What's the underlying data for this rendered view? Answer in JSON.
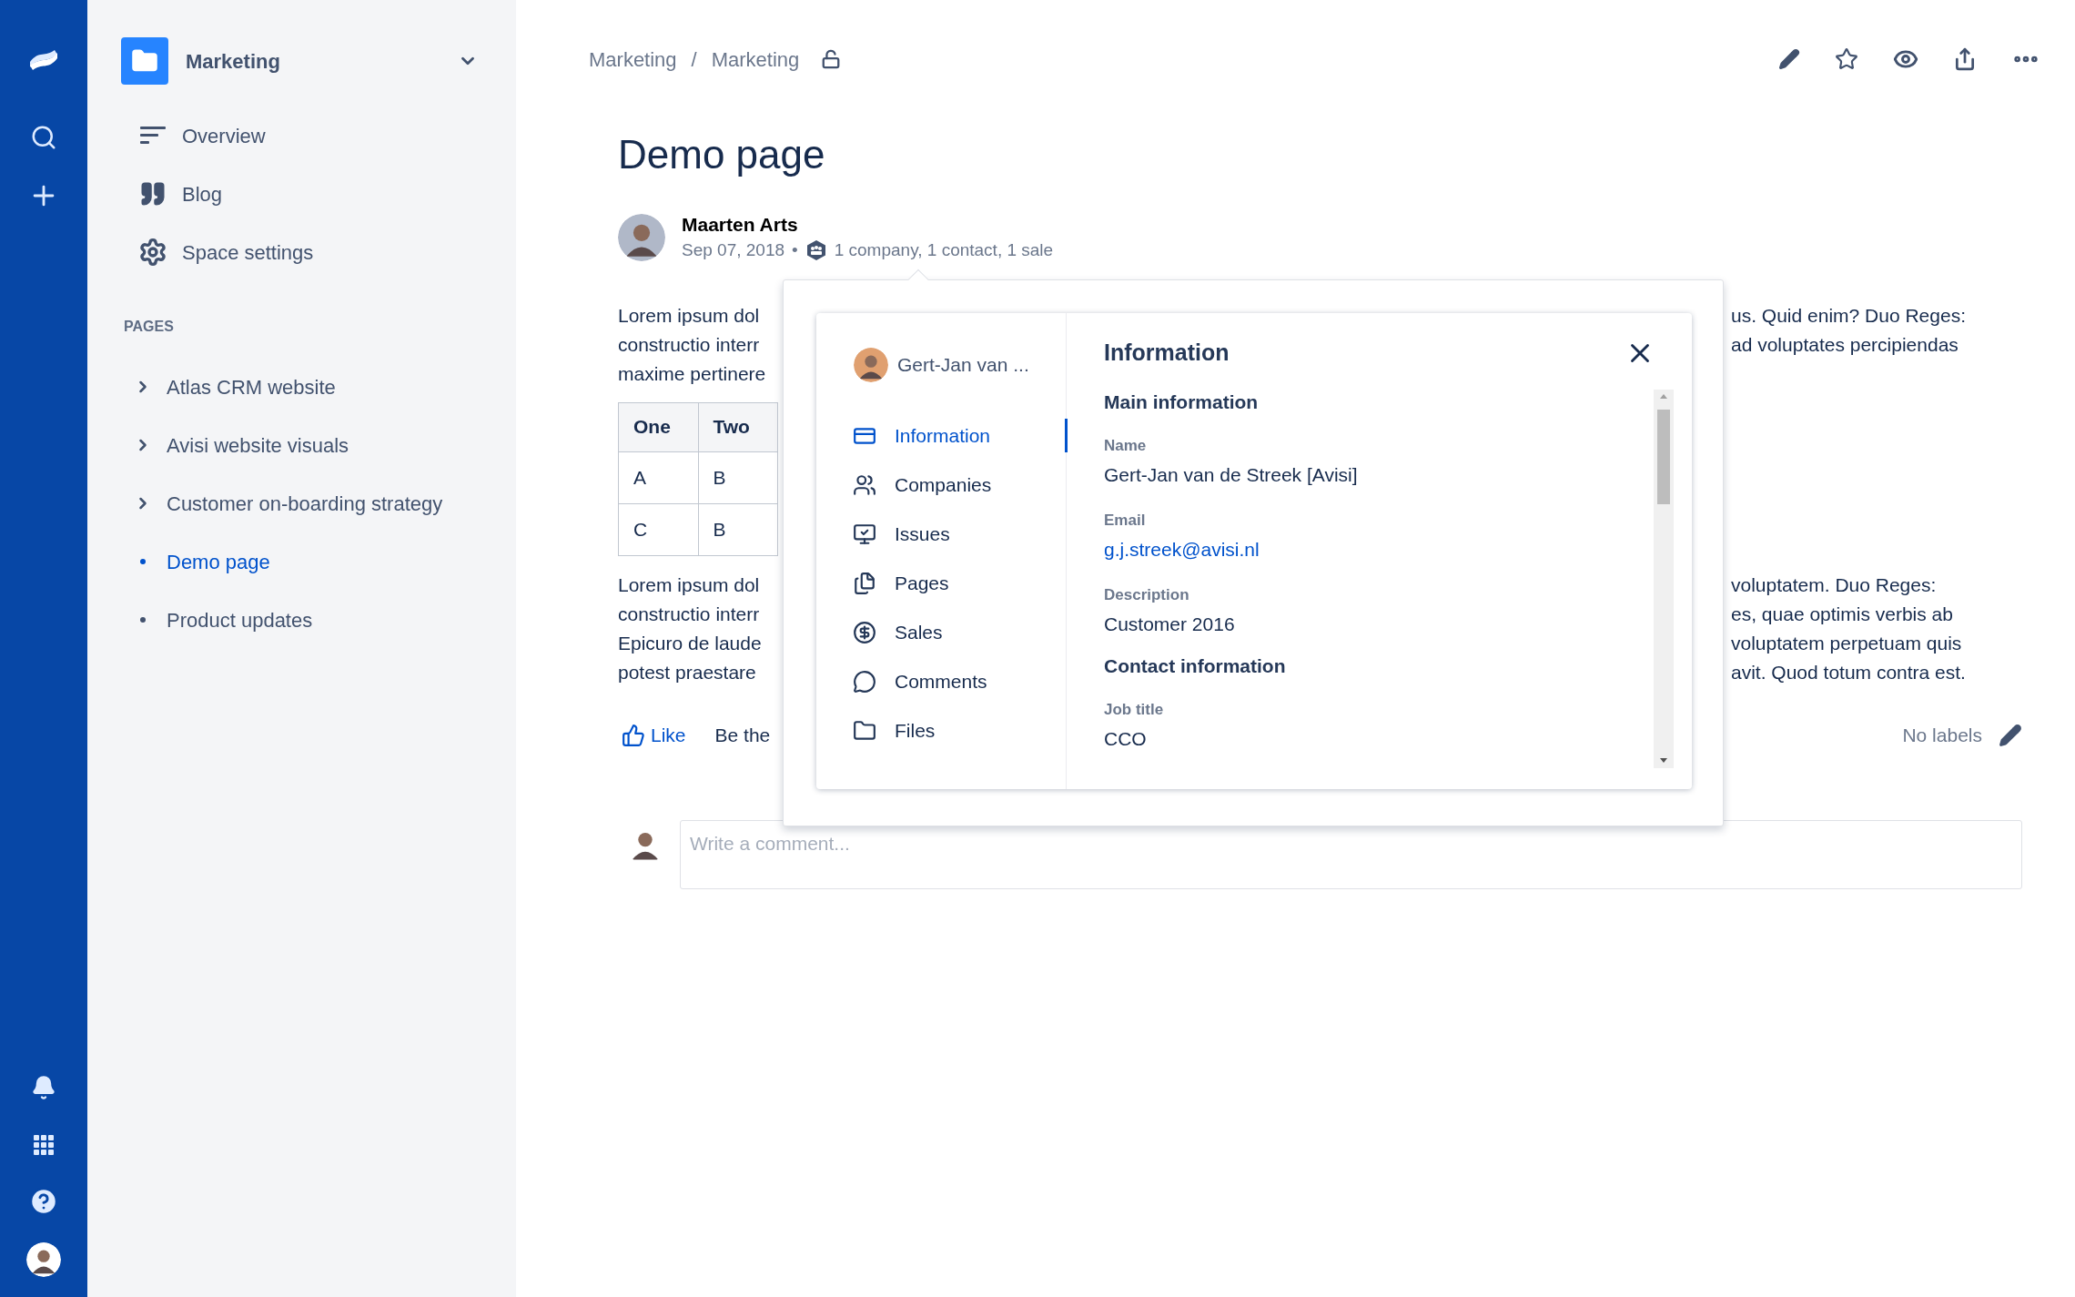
{
  "space": {
    "name": "Marketing"
  },
  "sidebar": {
    "items": [
      {
        "label": "Overview"
      },
      {
        "label": "Blog"
      },
      {
        "label": "Space settings"
      }
    ]
  },
  "pages_heading": "PAGES",
  "pages": [
    {
      "label": "Atlas CRM website",
      "has_children": true,
      "selected": false
    },
    {
      "label": "Avisi website visuals",
      "has_children": true,
      "selected": false
    },
    {
      "label": "Customer on-boarding strategy",
      "has_children": true,
      "selected": false
    },
    {
      "label": "Demo page",
      "has_children": false,
      "selected": true
    },
    {
      "label": "Product updates",
      "has_children": false,
      "selected": false
    }
  ],
  "breadcrumbs": [
    "Marketing",
    "Marketing"
  ],
  "breadcrumb_separator": "/",
  "title": "Demo page",
  "author": {
    "name": "Maarten Arts",
    "date": "Sep 07, 2018",
    "bullet": "•",
    "summary": "1 company, 1 contact, 1 sale"
  },
  "paragraphs": [
    {
      "left_lines": [
        "Lorem ipsum dol",
        "constructio interr",
        "maxime pertinere"
      ],
      "right_lines": [
        "us. Quid enim? Duo Reges:",
        "ad voluptates percipiendas"
      ]
    },
    {
      "left_lines": [
        "Lorem ipsum dol",
        "constructio interr",
        "Epicuro de laude",
        "potest praestare"
      ],
      "right_lines": [
        "voluptatem. Duo Reges:",
        "es, quae optimis verbis ab",
        "voluptatem perpetuam quis",
        "avit. Quod totum contra est."
      ]
    }
  ],
  "table": {
    "columns": [
      "One",
      "Two"
    ],
    "rows": [
      [
        "A",
        "B"
      ],
      [
        "C",
        "B"
      ]
    ]
  },
  "like": {
    "label": "Like",
    "text": "Be the"
  },
  "labels": "No labels",
  "comment": {
    "placeholder": "Write a comment..."
  },
  "popup": {
    "contact_name": "Gert-Jan van ...",
    "nav": [
      {
        "label": "Information",
        "selected": true
      },
      {
        "label": "Companies",
        "selected": false
      },
      {
        "label": "Issues",
        "selected": false
      },
      {
        "label": "Pages",
        "selected": false
      },
      {
        "label": "Sales",
        "selected": false
      },
      {
        "label": "Comments",
        "selected": false
      },
      {
        "label": "Files",
        "selected": false
      }
    ],
    "heading": "Information",
    "sections": [
      {
        "title": "Main information",
        "fields": [
          {
            "label": "Name",
            "value": "Gert-Jan van de Streek [Avisi]",
            "kind": "text"
          },
          {
            "label": "Email",
            "value": "g.j.streek@avisi.nl",
            "kind": "link"
          },
          {
            "label": "Description",
            "value": "Customer 2016",
            "kind": "text"
          }
        ]
      },
      {
        "title": "Contact information",
        "fields": [
          {
            "label": "Job title",
            "value": "CCO",
            "kind": "text"
          }
        ]
      }
    ]
  }
}
